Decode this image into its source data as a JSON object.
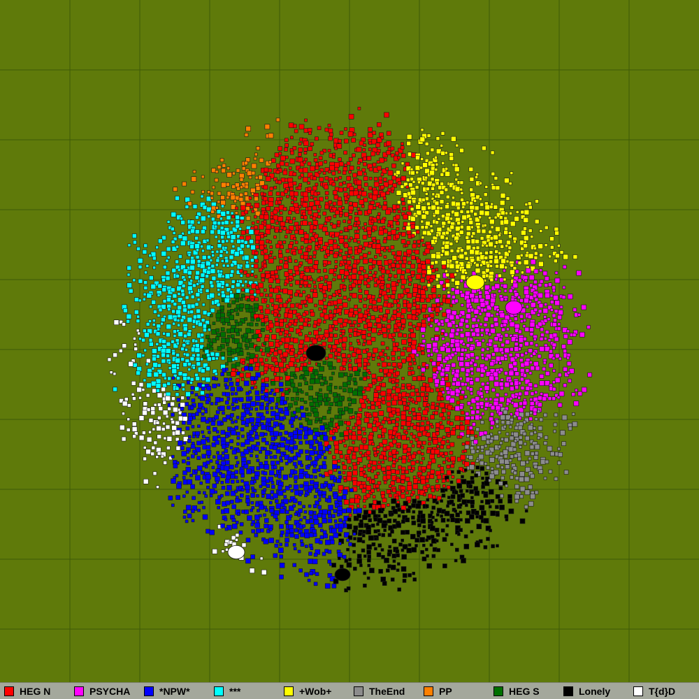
{
  "map": {
    "background_color": "#5f7a0a",
    "grid_color": "#3e5a08",
    "grid_divisions": 10
  },
  "territories": [
    {
      "id": "heg-n",
      "name": "HEG N",
      "color": "#ff0000"
    },
    {
      "id": "psycha",
      "name": "PSYCHA",
      "color": "#ff00ff"
    },
    {
      "id": "npw",
      "name": "*NPW*",
      "color": "#0000ff"
    },
    {
      "id": "stars",
      "name": "***",
      "color": "#00ffff"
    },
    {
      "id": "wob",
      "name": "+Wob+",
      "color": "#ffff00"
    },
    {
      "id": "theend",
      "name": "TheEnd",
      "color": "#8c8c8c"
    },
    {
      "id": "pp",
      "name": "PP",
      "color": "#ff8000"
    },
    {
      "id": "heg-s",
      "name": "HEG S",
      "color": "#007000"
    },
    {
      "id": "lonely",
      "name": "Lonely",
      "color": "#000000"
    },
    {
      "id": "tdd",
      "name": "T{d}D",
      "color": "#ffffff"
    }
  ]
}
